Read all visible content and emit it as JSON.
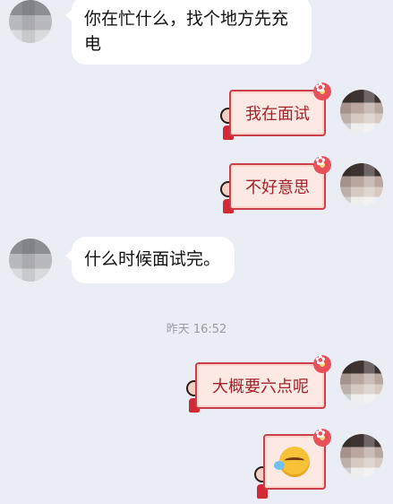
{
  "messages": {
    "m1": {
      "text": "你在忙什么，找个地方先充电"
    },
    "m2": {
      "text": "我在面试"
    },
    "m3": {
      "text": "不好意思"
    },
    "m4": {
      "text": "什么时候面试完。"
    },
    "timestamp": "昨天 16:52",
    "m5": {
      "text": "大概要六点呢"
    },
    "m6": {
      "icon": "crying-laughing-emoji-icon"
    }
  },
  "colors": {
    "background": "#eaedf4",
    "incoming_bubble": "#ffffff",
    "outgoing_bubble_fill": "#fde9e3",
    "outgoing_bubble_border": "#c9404a",
    "outgoing_text": "#a0222b",
    "timestamp": "#9a9ca3"
  }
}
